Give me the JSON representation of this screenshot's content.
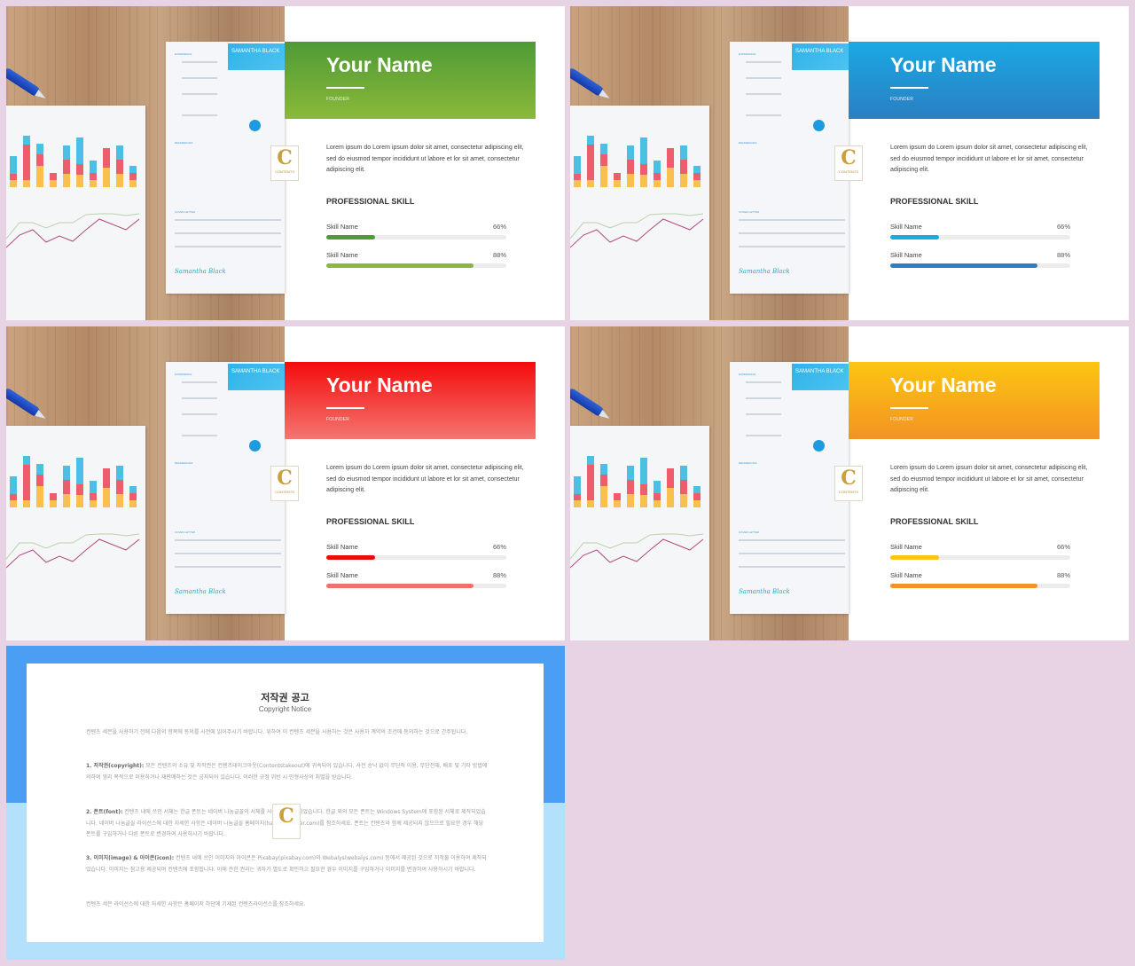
{
  "slides": [
    {
      "theme": "green",
      "colors": {
        "banner_top": "#4f9a35",
        "banner_bottom": "#8ab93a",
        "bar1": "#4f9a35",
        "bar2": "#8ab93a"
      },
      "name": "Your Name",
      "role": "FOUNDER",
      "description": "Lorem ipsum do Lorem ipsum dolor sit amet, consectetur adipiscing elit, sed do eiusmod tempor incididunt ut labore et lor sit amet, consectetur adipiscing elit.",
      "section_title": "PROFESSIONAL SKILL",
      "skills": [
        {
          "label": "Skill Name",
          "percent_label": "66%",
          "fill": 0.27
        },
        {
          "label": "Skill Name",
          "percent_label": "88%",
          "fill": 0.82
        }
      ]
    },
    {
      "theme": "blue",
      "colors": {
        "banner_top": "#1aa9e2",
        "banner_bottom": "#2a7fc4",
        "bar1": "#1ea9df",
        "bar2": "#2a7fc4"
      },
      "name": "Your Name",
      "role": "FOUNDER",
      "description": "Lorem ipsum do Lorem ipsum dolor sit amet, consectetur adipiscing elit, sed do eiusmod tempor incididunt ut labore et lor sit amet, consectetur adipiscing elit.",
      "section_title": "PROFESSIONAL SKILL",
      "skills": [
        {
          "label": "Skill Name",
          "percent_label": "66%",
          "fill": 0.27
        },
        {
          "label": "Skill Name",
          "percent_label": "88%",
          "fill": 0.82
        }
      ]
    },
    {
      "theme": "red",
      "colors": {
        "banner_top": "#f40c0c",
        "banner_bottom": "#f5756f",
        "bar1": "#ee0a0a",
        "bar2": "#f2706a"
      },
      "name": "Your Name",
      "role": "FOUNDER",
      "description": "Lorem ipsum do Lorem ipsum dolor sit amet, consectetur adipiscing elit, sed do eiusmod tempor incididunt ut labore et lor sit amet, consectetur adipiscing elit.",
      "section_title": "PROFESSIONAL SKILL",
      "skills": [
        {
          "label": "Skill Name",
          "percent_label": "66%",
          "fill": 0.27
        },
        {
          "label": "Skill Name",
          "percent_label": "88%",
          "fill": 0.82
        }
      ]
    },
    {
      "theme": "orange",
      "colors": {
        "banner_top": "#fcc512",
        "banner_bottom": "#f49322",
        "bar1": "#fcc512",
        "bar2": "#f49322"
      },
      "name": "Your Name",
      "role": "FOUNDER",
      "description": "Lorem ipsum do Lorem ipsum dolor sit amet, consectetur adipiscing elit, sed do eiusmod tempor incididunt ut labore et lor sit amet, consectetur adipiscing elit.",
      "section_title": "PROFESSIONAL SKILL",
      "skills": [
        {
          "label": "Skill Name",
          "percent_label": "66%",
          "fill": 0.27
        },
        {
          "label": "Skill Name",
          "percent_label": "88%",
          "fill": 0.82
        }
      ]
    }
  ],
  "photo": {
    "resume_name": "SAMANTHA BLACK",
    "signature": "Samantha Black",
    "watermark_letter": "C",
    "watermark_text": "CONTENTS"
  },
  "copyright": {
    "title": "저작권 공고",
    "subtitle": "Copyright Notice",
    "intro": "컨텐츠 세븐을 사용하기 전에 다음의 항목에 동의를 사전에 읽어주시기 바랍니다. 위하여 이 컨텐츠 세븐을 사용하는 것은 사용자 계약의 조건에 동의하는 것으로 간주됩니다.",
    "sections": [
      {
        "heading": "1. 저작권(copyright):",
        "body": "모든 컨텐츠의 소유 및 저작권은 컨텐츠테이크아웃(Contentstakeout)에 귀속되어 있습니다. 사전 승낙 없이 무단적 이용, 무단전재, 배포 및 기타 방법에 의하여 영리 목적으로 이용하거나 재판매하는 것은 금지되어 있습니다. 이러한 규정 위반 시 민형사상의 처벌을 받습니다."
      },
      {
        "heading": "2. 폰트(font):",
        "body": "컨텐츠 내에 쓰인 서체는 한글 폰트는 네이버 나눔글꼴의 서체를 사용하여 제작되었습니다. 한글 외의 모든 폰트는 Windows System에 포함된 서체로 제작되었습니다. 네이버 나눔글꼴 라이선스에 대한 자세한 사항은 네이버 나눔글꼴 홈페이지(hangeul.naver.com)를 참조하세요. 폰트는 컨텐츠와 함께 제공되지 않으므로 필요한 경우 해당 폰트를 구입하거나 다른 폰트로 변경하여 사용하시기 바랍니다."
      },
      {
        "heading": "3. 이미지(image) & 아이콘(icon):",
        "body": "컨텐츠 내에 쓰인 이미지와 아이콘은 Pixabay(pixabay.com)와 Webalys(webalys.com) 등에서 제공된 것으로 저작물 이용하여 제작되었습니다. 이미지는 참고용 제공되며 컨텐츠에 포함됩니다. 이에 관한 권리는 귀하가 별도로 확인하고 필요한 경우 이미지를 구입하거나 이미지를 변경하여 사용하시기 바랍니다."
      }
    ],
    "footer": "컨텐츠 세븐 라이선스에 대한 자세한 사항은 홈페이지 하단에 기재된 컨텐츠라이선스를 참조하세요.",
    "colors": {
      "top": "#4a9ff5",
      "bottom": "#b3e0fb"
    }
  }
}
